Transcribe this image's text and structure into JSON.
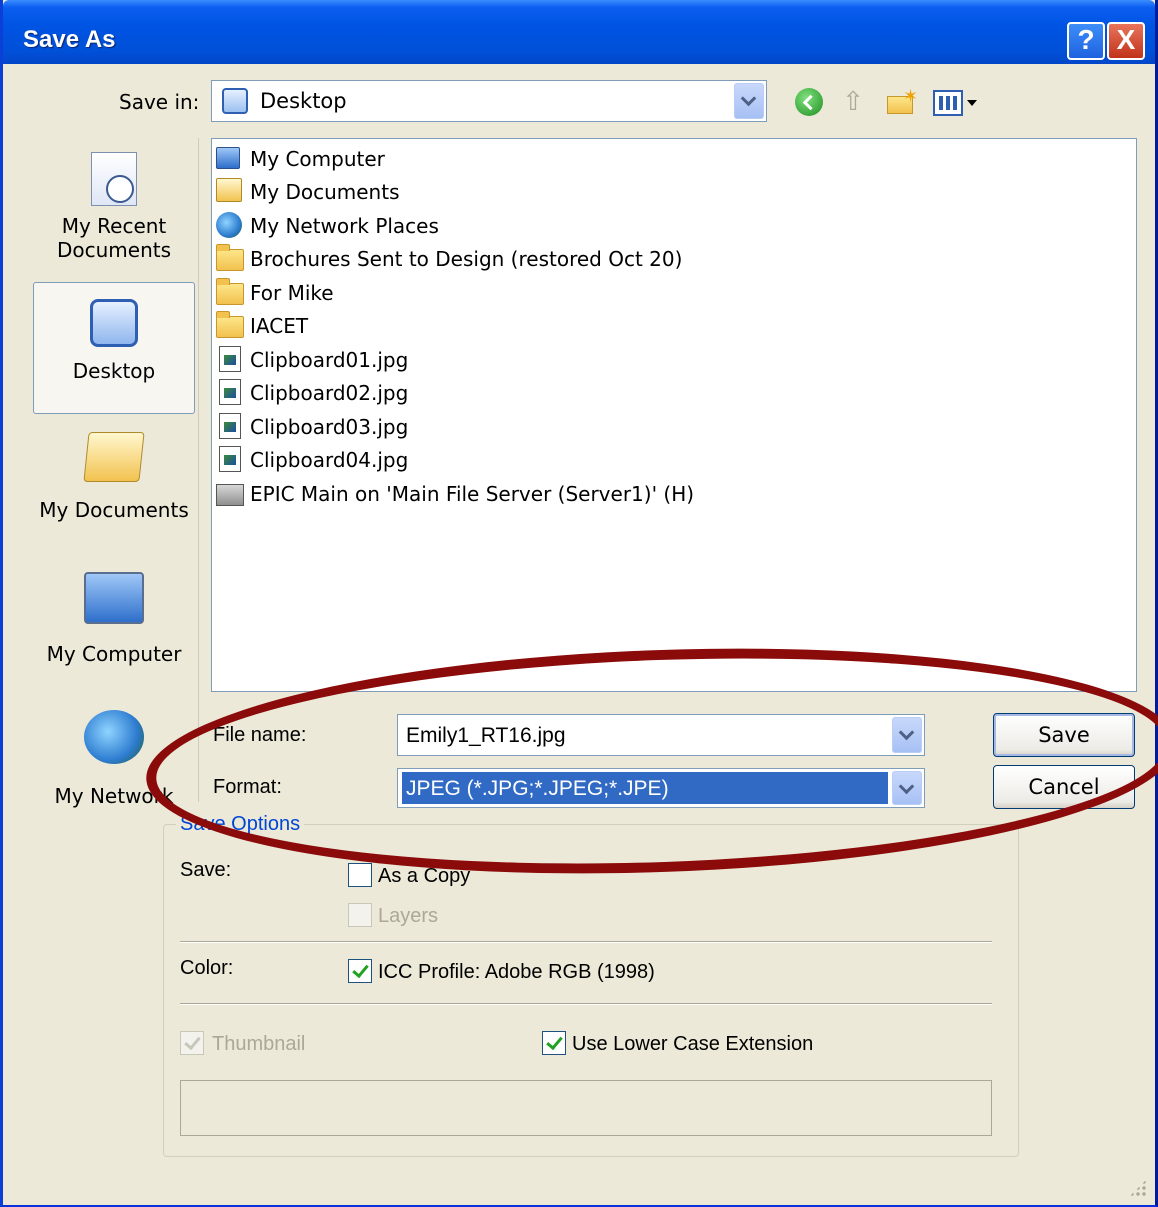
{
  "window": {
    "title": "Save As",
    "help_glyph": "?",
    "close_glyph": "X"
  },
  "toolbar": {
    "save_in_label": "Save in:",
    "location": "Desktop",
    "icons": [
      "back-icon",
      "up-folder-icon",
      "new-folder-icon",
      "views-menu-icon"
    ]
  },
  "places": [
    {
      "label_line1": "My Recent",
      "label_line2": "Documents",
      "icon": "recent-documents-icon"
    },
    {
      "label_line1": "Desktop",
      "label_line2": "",
      "icon": "desktop-icon"
    },
    {
      "label_line1": "My Documents",
      "label_line2": "",
      "icon": "my-documents-icon"
    },
    {
      "label_line1": "My Computer",
      "label_line2": "",
      "icon": "my-computer-icon"
    },
    {
      "label_line1": "My Network",
      "label_line2": "",
      "icon": "my-network-icon"
    }
  ],
  "files": [
    {
      "name": "My Computer",
      "icon": "computer-icon"
    },
    {
      "name": "My Documents",
      "icon": "documents-icon"
    },
    {
      "name": "My Network Places",
      "icon": "network-icon"
    },
    {
      "name": "Brochures Sent to Design (restored Oct 20)",
      "icon": "folder-icon"
    },
    {
      "name": "For Mike",
      "icon": "folder-icon"
    },
    {
      "name": "IACET",
      "icon": "folder-icon"
    },
    {
      "name": "Clipboard01.jpg",
      "icon": "image-file-icon"
    },
    {
      "name": "Clipboard02.jpg",
      "icon": "image-file-icon"
    },
    {
      "name": "Clipboard03.jpg",
      "icon": "image-file-icon"
    },
    {
      "name": "Clipboard04.jpg",
      "icon": "image-file-icon"
    },
    {
      "name": "EPIC Main on 'Main File Server (Server1)' (H)",
      "icon": "network-drive-icon"
    }
  ],
  "form": {
    "file_name_label": "File name:",
    "file_name_value": "Emily1_RT16.jpg",
    "format_label": "Format:",
    "format_value": "JPEG (*.JPG;*.JPEG;*.JPE)",
    "save_button": "Save",
    "cancel_button": "Cancel"
  },
  "save_options": {
    "title": "Save Options",
    "save_label": "Save:",
    "as_a_copy": {
      "label": "As a Copy",
      "checked": false,
      "enabled": true
    },
    "layers": {
      "label": "Layers",
      "checked": false,
      "enabled": false
    },
    "color_label": "Color:",
    "icc_profile": {
      "label": "ICC Profile:  Adobe RGB (1998)",
      "checked": true,
      "enabled": true
    },
    "thumbnail": {
      "label": "Thumbnail",
      "checked": true,
      "enabled": false
    },
    "lower_case_ext": {
      "label": "Use Lower Case Extension",
      "checked": true,
      "enabled": true
    }
  },
  "colors": {
    "titlebar": "#0054e3",
    "selection": "#316ac5",
    "annotation": "#8b0a0a",
    "group_title": "#0046d5"
  }
}
